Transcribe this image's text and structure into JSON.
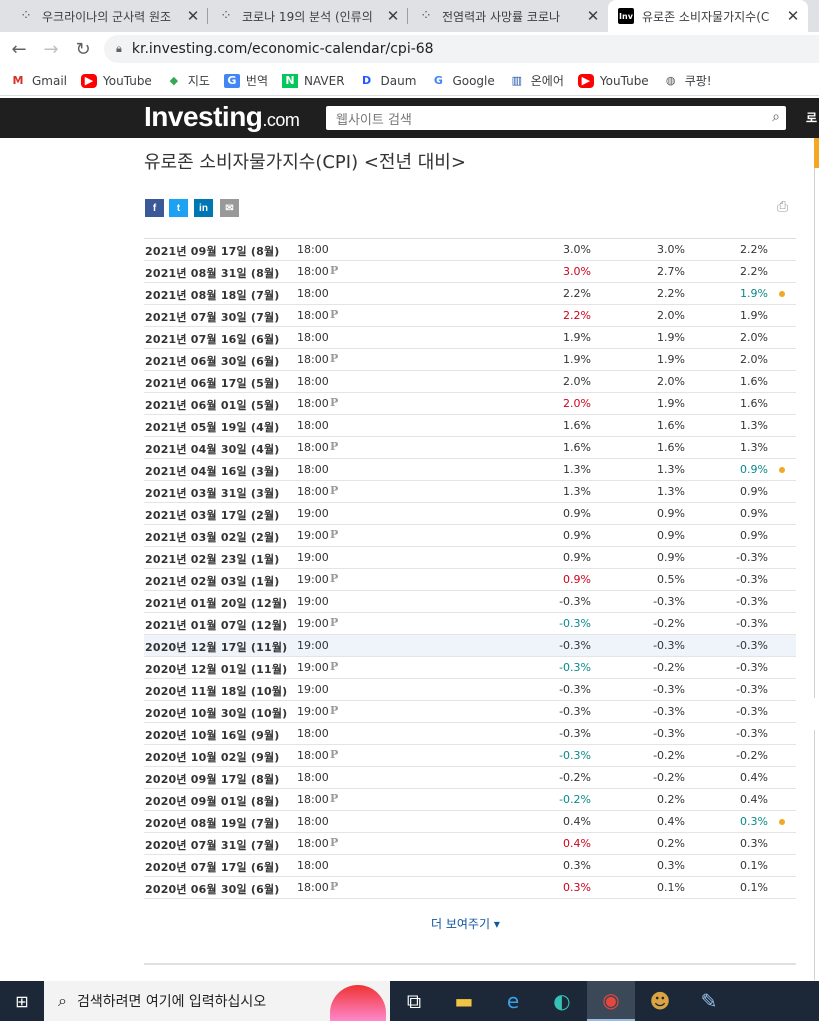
{
  "browser": {
    "tabs": [
      {
        "title": "우크라이나의 군사력 원조",
        "favicon": "dots-icon"
      },
      {
        "title": "코로나 19의 분석 (인류의",
        "favicon": "dots-icon"
      },
      {
        "title": "전염력과 사망률 코로나",
        "favicon": "dots-icon"
      },
      {
        "title": "유로존 소비자물가지수(C",
        "favicon": "Inv"
      }
    ],
    "url": "kr.investing.com/economic-calendar/cpi-68",
    "bookmarks": [
      {
        "label": "Gmail",
        "icon": "M"
      },
      {
        "label": "YouTube",
        "icon": "▶"
      },
      {
        "label": "지도",
        "icon": "◆"
      },
      {
        "label": "번역",
        "icon": "G"
      },
      {
        "label": "NAVER",
        "icon": "N"
      },
      {
        "label": "Daum",
        "icon": "D"
      },
      {
        "label": "Google",
        "icon": "G"
      },
      {
        "label": "온에어",
        "icon": "▥"
      },
      {
        "label": "YouTube",
        "icon": "▶"
      },
      {
        "label": "쿠팡!",
        "icon": "◍"
      }
    ]
  },
  "site": {
    "logo_main": "Investing",
    "logo_suffix": ".com",
    "search_placeholder": "웹사이트 검색",
    "login_fragment": "로"
  },
  "page": {
    "title": "유로존 소비자물가지수(CPI) <전년 대비>",
    "share": [
      "f",
      "t",
      "in",
      "✉"
    ],
    "more_label": "더 보여주기 ▾"
  },
  "history": [
    {
      "date": "2021년 09월 17일 (8월)",
      "time": "18:00",
      "p": false,
      "actual": "3.0%",
      "actual_color": "normal",
      "forecast": "3.0%",
      "previous": "2.2%",
      "prev_color": "normal",
      "dot": false
    },
    {
      "date": "2021년 08월 31일 (8월)",
      "time": "18:00",
      "p": true,
      "actual": "3.0%",
      "actual_color": "red",
      "forecast": "2.7%",
      "previous": "2.2%",
      "prev_color": "normal",
      "dot": false
    },
    {
      "date": "2021년 08월 18일 (7월)",
      "time": "18:00",
      "p": false,
      "actual": "2.2%",
      "actual_color": "normal",
      "forecast": "2.2%",
      "previous": "1.9%",
      "prev_color": "green",
      "dot": true
    },
    {
      "date": "2021년 07월 30일 (7월)",
      "time": "18:00",
      "p": true,
      "actual": "2.2%",
      "actual_color": "red",
      "forecast": "2.0%",
      "previous": "1.9%",
      "prev_color": "normal",
      "dot": false
    },
    {
      "date": "2021년 07월 16일 (6월)",
      "time": "18:00",
      "p": false,
      "actual": "1.9%",
      "actual_color": "normal",
      "forecast": "1.9%",
      "previous": "2.0%",
      "prev_color": "normal",
      "dot": false
    },
    {
      "date": "2021년 06월 30일 (6월)",
      "time": "18:00",
      "p": true,
      "actual": "1.9%",
      "actual_color": "normal",
      "forecast": "1.9%",
      "previous": "2.0%",
      "prev_color": "normal",
      "dot": false
    },
    {
      "date": "2021년 06월 17일 (5월)",
      "time": "18:00",
      "p": false,
      "actual": "2.0%",
      "actual_color": "normal",
      "forecast": "2.0%",
      "previous": "1.6%",
      "prev_color": "normal",
      "dot": false
    },
    {
      "date": "2021년 06월 01일 (5월)",
      "time": "18:00",
      "p": true,
      "actual": "2.0%",
      "actual_color": "red",
      "forecast": "1.9%",
      "previous": "1.6%",
      "prev_color": "normal",
      "dot": false
    },
    {
      "date": "2021년 05월 19일 (4월)",
      "time": "18:00",
      "p": false,
      "actual": "1.6%",
      "actual_color": "normal",
      "forecast": "1.6%",
      "previous": "1.3%",
      "prev_color": "normal",
      "dot": false
    },
    {
      "date": "2021년 04월 30일 (4월)",
      "time": "18:00",
      "p": true,
      "actual": "1.6%",
      "actual_color": "normal",
      "forecast": "1.6%",
      "previous": "1.3%",
      "prev_color": "normal",
      "dot": false
    },
    {
      "date": "2021년 04월 16일 (3월)",
      "time": "18:00",
      "p": false,
      "actual": "1.3%",
      "actual_color": "normal",
      "forecast": "1.3%",
      "previous": "0.9%",
      "prev_color": "green",
      "dot": true
    },
    {
      "date": "2021년 03월 31일 (3월)",
      "time": "18:00",
      "p": true,
      "actual": "1.3%",
      "actual_color": "normal",
      "forecast": "1.3%",
      "previous": "0.9%",
      "prev_color": "normal",
      "dot": false
    },
    {
      "date": "2021년 03월 17일 (2월)",
      "time": "19:00",
      "p": false,
      "actual": "0.9%",
      "actual_color": "normal",
      "forecast": "0.9%",
      "previous": "0.9%",
      "prev_color": "normal",
      "dot": false
    },
    {
      "date": "2021년 03월 02일 (2월)",
      "time": "19:00",
      "p": true,
      "actual": "0.9%",
      "actual_color": "normal",
      "forecast": "0.9%",
      "previous": "0.9%",
      "prev_color": "normal",
      "dot": false
    },
    {
      "date": "2021년 02월 23일 (1월)",
      "time": "19:00",
      "p": false,
      "actual": "0.9%",
      "actual_color": "normal",
      "forecast": "0.9%",
      "previous": "-0.3%",
      "prev_color": "normal",
      "dot": false
    },
    {
      "date": "2021년 02월 03일 (1월)",
      "time": "19:00",
      "p": true,
      "actual": "0.9%",
      "actual_color": "red",
      "forecast": "0.5%",
      "previous": "-0.3%",
      "prev_color": "normal",
      "dot": false
    },
    {
      "date": "2021년 01월 20일 (12월)",
      "time": "19:00",
      "p": false,
      "actual": "-0.3%",
      "actual_color": "normal",
      "forecast": "-0.3%",
      "previous": "-0.3%",
      "prev_color": "normal",
      "dot": false
    },
    {
      "date": "2021년 01월 07일 (12월)",
      "time": "19:00",
      "p": true,
      "actual": "-0.3%",
      "actual_color": "green",
      "forecast": "-0.2%",
      "previous": "-0.3%",
      "prev_color": "normal",
      "dot": false
    },
    {
      "date": "2020년 12월 17일 (11월)",
      "time": "19:00",
      "p": false,
      "actual": "-0.3%",
      "actual_color": "normal",
      "forecast": "-0.3%",
      "previous": "-0.3%",
      "prev_color": "normal",
      "dot": false,
      "highlight": true
    },
    {
      "date": "2020년 12월 01일 (11월)",
      "time": "19:00",
      "p": true,
      "actual": "-0.3%",
      "actual_color": "green",
      "forecast": "-0.2%",
      "previous": "-0.3%",
      "prev_color": "normal",
      "dot": false
    },
    {
      "date": "2020년 11월 18일 (10월)",
      "time": "19:00",
      "p": false,
      "actual": "-0.3%",
      "actual_color": "normal",
      "forecast": "-0.3%",
      "previous": "-0.3%",
      "prev_color": "normal",
      "dot": false
    },
    {
      "date": "2020년 10월 30일 (10월)",
      "time": "19:00",
      "p": true,
      "actual": "-0.3%",
      "actual_color": "normal",
      "forecast": "-0.3%",
      "previous": "-0.3%",
      "prev_color": "normal",
      "dot": false
    },
    {
      "date": "2020년 10월 16일 (9월)",
      "time": "18:00",
      "p": false,
      "actual": "-0.3%",
      "actual_color": "normal",
      "forecast": "-0.3%",
      "previous": "-0.3%",
      "prev_color": "normal",
      "dot": false
    },
    {
      "date": "2020년 10월 02일 (9월)",
      "time": "18:00",
      "p": true,
      "actual": "-0.3%",
      "actual_color": "green",
      "forecast": "-0.2%",
      "previous": "-0.2%",
      "prev_color": "normal",
      "dot": false
    },
    {
      "date": "2020년 09월 17일 (8월)",
      "time": "18:00",
      "p": false,
      "actual": "-0.2%",
      "actual_color": "normal",
      "forecast": "-0.2%",
      "previous": "0.4%",
      "prev_color": "normal",
      "dot": false
    },
    {
      "date": "2020년 09월 01일 (8월)",
      "time": "18:00",
      "p": true,
      "actual": "-0.2%",
      "actual_color": "green",
      "forecast": "0.2%",
      "previous": "0.4%",
      "prev_color": "normal",
      "dot": false
    },
    {
      "date": "2020년 08월 19일 (7월)",
      "time": "18:00",
      "p": false,
      "actual": "0.4%",
      "actual_color": "normal",
      "forecast": "0.4%",
      "previous": "0.3%",
      "prev_color": "green",
      "dot": true
    },
    {
      "date": "2020년 07월 31일 (7월)",
      "time": "18:00",
      "p": true,
      "actual": "0.4%",
      "actual_color": "red",
      "forecast": "0.2%",
      "previous": "0.3%",
      "prev_color": "normal",
      "dot": false
    },
    {
      "date": "2020년 07월 17일 (6월)",
      "time": "18:00",
      "p": false,
      "actual": "0.3%",
      "actual_color": "normal",
      "forecast": "0.3%",
      "previous": "0.1%",
      "prev_color": "normal",
      "dot": false
    },
    {
      "date": "2020년 06월 30일 (6월)",
      "time": "18:00",
      "p": true,
      "actual": "0.3%",
      "actual_color": "red",
      "forecast": "0.1%",
      "previous": "0.1%",
      "prev_color": "normal",
      "dot": false
    }
  ],
  "taskbar": {
    "search_placeholder": "검색하려면 여기에 입력하십시오"
  },
  "colors": {
    "red": "#d0021b",
    "green": "#0a8a8a",
    "dot": "#f5a623",
    "site_header": "#1f1f1f"
  }
}
